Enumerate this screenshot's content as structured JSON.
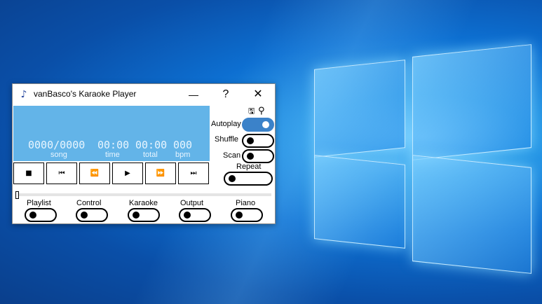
{
  "window": {
    "title": "vanBasco's Karaoke Player",
    "help_label": "?",
    "close_label": "✕",
    "minimize_label": "—"
  },
  "display": {
    "song_counter": "0000/0000",
    "song_label": "song",
    "time_value": "00:00",
    "time_label": "time",
    "total_value": "00:00",
    "total_label": "total",
    "bpm_value": "000",
    "bpm_label": "bpm"
  },
  "transport": {
    "stop": "■",
    "first": "⏮",
    "rewind": "⏪",
    "play": "▶",
    "forward": "⏩",
    "last": "⏭"
  },
  "options": {
    "autoplay": {
      "label": "Autoplay",
      "on": true
    },
    "shuffle": {
      "label": "Shuffle",
      "on": false
    },
    "scan": {
      "label": "Scan",
      "on": false
    },
    "repeat": {
      "label": "Repeat",
      "on": false
    }
  },
  "tabs": [
    {
      "label": "Playlist",
      "on": false
    },
    {
      "label": "Control",
      "on": false
    },
    {
      "label": "Karaoke",
      "on": false
    },
    {
      "label": "Output",
      "on": false
    },
    {
      "label": "Piano",
      "on": false
    }
  ],
  "icons": {
    "save": "💾",
    "search": "⚲"
  },
  "colors": {
    "display_bg": "#63b4e8",
    "toggle_on": "#3b82c9"
  }
}
